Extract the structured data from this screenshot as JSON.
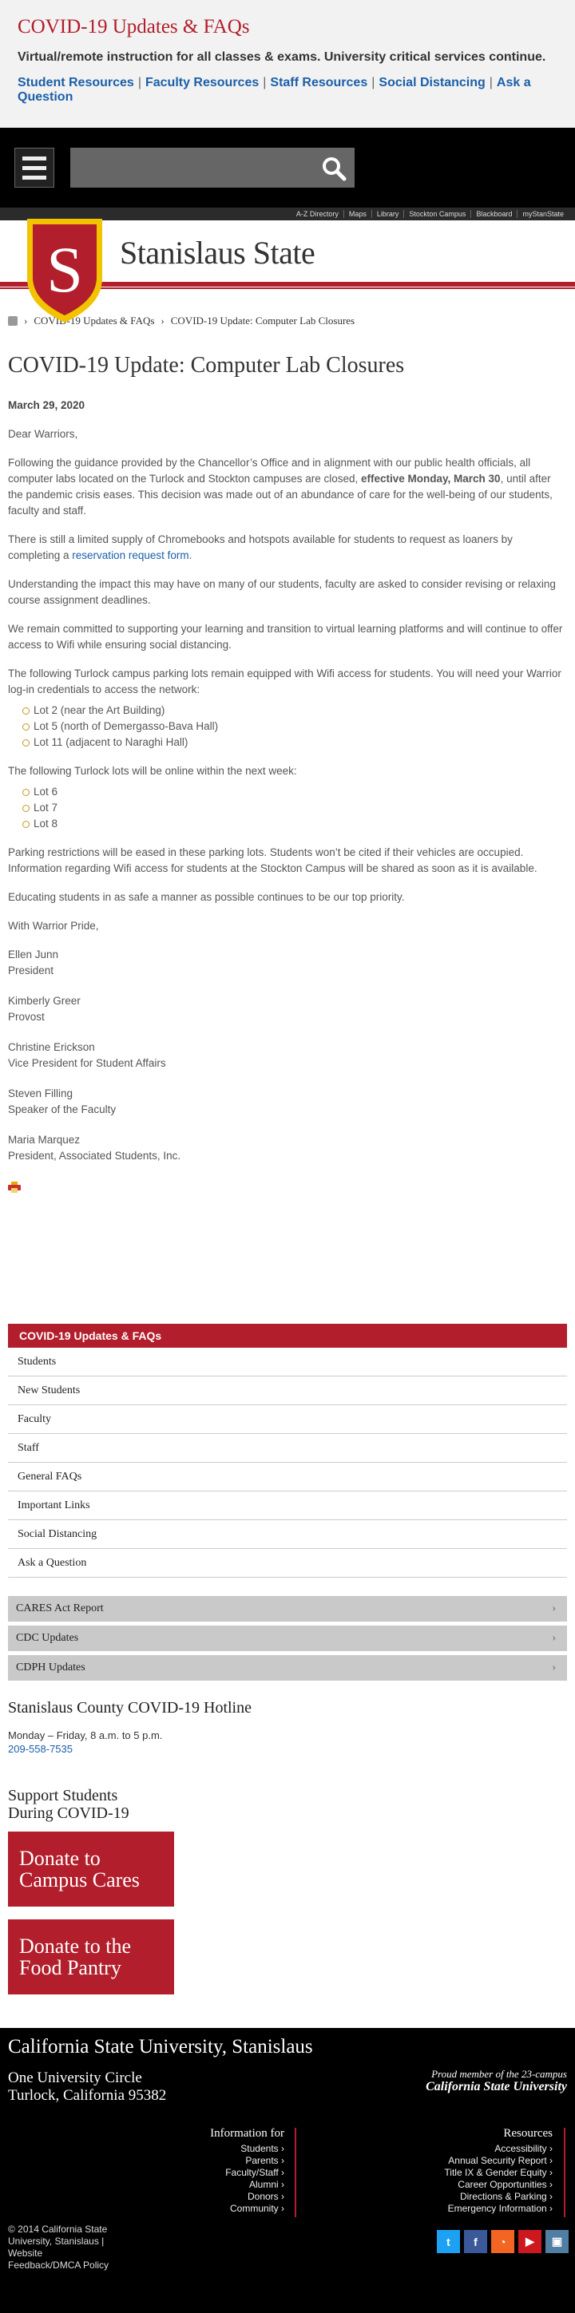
{
  "banner": {
    "title": "COVID-19 Updates & FAQs",
    "subtitle": "Virtual/remote instruction for all classes & exams. University critical services continue.",
    "links": [
      "Student Resources",
      "Faculty Resources",
      "Staff Resources",
      "Social Distancing",
      "Ask a Question"
    ],
    "separator": "|"
  },
  "topbar": {
    "menu_icon": "hamburger-menu-icon",
    "search_icon": "search-icon"
  },
  "utility_nav": [
    "A-Z Directory",
    "Maps",
    "Library",
    "Stockton Campus",
    "Blackboard",
    "myStanState"
  ],
  "header": {
    "logo_text": "Stanislaus State",
    "logo_letter": "S"
  },
  "breadcrumb": {
    "items": [
      "COVID-19 Updates & FAQs",
      "COVID-19 Update: Computer Lab Closures"
    ],
    "separator": "›"
  },
  "article": {
    "title": "COVID-19 Update: Computer Lab Closures",
    "date": "March 29, 2020",
    "greeting": "Dear Warriors,",
    "p1_a": "Following the guidance provided by the Chancellor’s Office and in alignment with our public health officials, all computer labs located on the Turlock and Stockton campuses are closed, ",
    "p1_b": "effective Monday, March 30",
    "p1_c": ", until after the pandemic crisis eases. This decision was made out of an abundance of care for the well-being of our students, faculty and staff.",
    "p2_a": "There is still a limited supply of Chromebooks and hotspots available for students to request as loaners by completing a ",
    "p2_link": "reservation request form",
    "p2_c": ".",
    "p3": "Understanding the impact this may have on many of our students, faculty are asked to consider revising or relaxing course assignment deadlines.",
    "p4": "We remain committed to supporting your learning and transition to virtual learning platforms and will continue to offer access to Wifi while ensuring social distancing.",
    "p5": "The following Turlock campus parking lots remain equipped with Wifi access for students. You will need your Warrior log-in credentials to access the network:",
    "lots_current": [
      "Lot 2 (near the Art Building)",
      "Lot 5 (north of Demergasso-Bava Hall)",
      "Lot 11 (adjacent to Naraghi Hall)"
    ],
    "p6": "The following Turlock lots will be online within the next week:",
    "lots_next": [
      "Lot 6",
      "Lot 7",
      "Lot 8"
    ],
    "p7": "Parking restrictions will be eased in these parking lots. Students won’t be cited if their vehicles are occupied. Information regarding Wifi access for students at the Stockton Campus will be shared as soon as it is available.",
    "p8": "Educating students in as safe a manner as possible continues to be our top priority.",
    "closing": "With Warrior Pride,",
    "signatures": [
      {
        "name": "Ellen Junn",
        "title": "President"
      },
      {
        "name": "Kimberly Greer",
        "title": "Provost"
      },
      {
        "name": "Christine Erickson",
        "title": "Vice President for Student Affairs"
      },
      {
        "name": "Steven Filling",
        "title": "Speaker of the Faculty"
      },
      {
        "name": "Maria Marquez",
        "title": "President, Associated Students, Inc."
      }
    ],
    "print_icon": "printer-icon"
  },
  "sidemenu": {
    "heading": "COVID-19 Updates & FAQs",
    "items": [
      "Students",
      "New Students",
      "Faculty",
      "Staff",
      "General FAQs",
      "Important Links",
      "Social Distancing",
      "Ask a Question"
    ],
    "gray_items": [
      "CARES Act Report",
      "CDC Updates",
      "CDPH Updates"
    ]
  },
  "hotline": {
    "title": "Stanislaus County COVID-19 Hotline",
    "hours": "Monday – Friday, 8 a.m. to 5 p.m.",
    "phone": "209-558-7535"
  },
  "support": {
    "title_line1": "Support Students",
    "title_line2": "During COVID-19",
    "donate1_l1": "Donate to",
    "donate1_l2": "Campus Cares",
    "donate2_l1": "Donate to the",
    "donate2_l2": "Food Pantry"
  },
  "footer": {
    "title": "California State University, Stanislaus",
    "address_l1": "One University Circle",
    "address_l2": "Turlock, California 95382",
    "proud_l1": "Proud member of the 23-campus",
    "proud_l2": "California State University",
    "info_heading": "Information for",
    "info_items": [
      "Students ›",
      "Parents ›",
      "Faculty/Staff ›",
      "Alumni ›",
      "Donors ›",
      "Community ›"
    ],
    "res_heading": "Resources",
    "res_items": [
      "Accessibility ›",
      "Annual Security Report ›",
      "Title IX & Gender Equity ›",
      "Career Opportunities ›",
      "Directions & Parking ›",
      "Emergency Information ›"
    ],
    "copy_l1": "© 2014 California State",
    "copy_l2": "University, Stanislaus |",
    "copy_l3": "Website",
    "copy_l4": "Feedback/DMCA Policy",
    "social": [
      {
        "icon": "twitter-icon",
        "glyph": "t",
        "color": "#1da1f2"
      },
      {
        "icon": "facebook-icon",
        "glyph": "f",
        "color": "#3b5998"
      },
      {
        "icon": "rss-icon",
        "glyph": "◔",
        "color": "#f26522"
      },
      {
        "icon": "youtube-icon",
        "glyph": "▶",
        "color": "#cc181e"
      },
      {
        "icon": "instagram-icon",
        "glyph": "▣",
        "color": "#517fa4"
      }
    ]
  }
}
